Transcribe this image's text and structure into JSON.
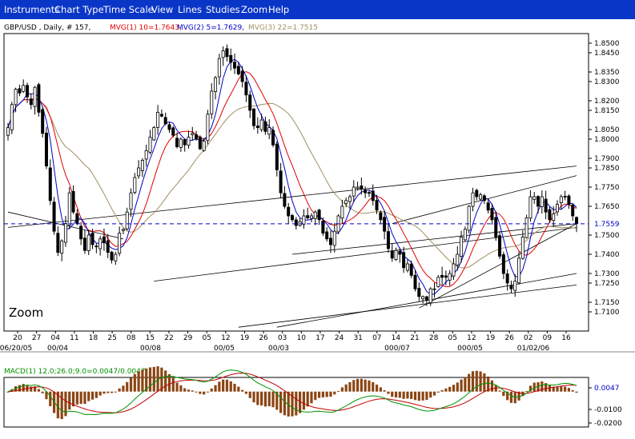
{
  "menu": [
    {
      "id": "instruments",
      "label": "Instruments"
    },
    {
      "id": "chart-type",
      "label": "Chart Type"
    },
    {
      "id": "time-scale",
      "label": "Time Scale"
    },
    {
      "id": "view",
      "label": "View"
    },
    {
      "id": "lines",
      "label": "Lines"
    },
    {
      "id": "studies",
      "label": "Studies"
    },
    {
      "id": "zoom",
      "label": "Zoom"
    },
    {
      "id": "help",
      "label": "Help"
    }
  ],
  "price_panel": {
    "header_symbol": "GBP/USD , Daily, # 157,",
    "mvg1": "MVG(1) 10=1.7643,",
    "mvg2": "MVG(2) 5=1.7629,",
    "mvg3": "MVG(3) 22=1.7515",
    "zoom_label": "Zoom",
    "current_price_tag": "1.7559"
  },
  "macd_panel": {
    "header": "MACD(1) 12.0;26.0;9.0=0.0047/0.0047",
    "value_tag": "0.0047",
    "ticks": [
      -0.01,
      -0.02
    ]
  },
  "colors": {
    "menu_bg": "#0a36c8",
    "mvg1": "#e00000",
    "mvg2": "#0000c8",
    "mvg3": "#a09060",
    "candle_up": "#ffffff",
    "candle_down": "#000000",
    "macd_bar": "#8b4513",
    "macd_line": "#009000",
    "signal_line": "#c00000",
    "price_marker": "#0000c8"
  },
  "chart_data": [
    {
      "type": "candlestick",
      "instrument": "GBP/USD",
      "interval": "Daily",
      "ylim": [
        1.7,
        1.855
      ],
      "yticks": [
        1.85,
        1.845,
        1.835,
        1.83,
        1.82,
        1.815,
        1.805,
        1.8,
        1.79,
        1.785,
        1.775,
        1.765,
        1.75,
        1.74,
        1.73,
        1.725,
        1.715,
        1.71
      ],
      "xticks": [
        "20",
        "27",
        "04",
        "11",
        "18",
        "25",
        "08",
        "15",
        "22",
        "29",
        "05",
        "12",
        "19",
        "26",
        "03",
        "10",
        "17",
        "24",
        "31",
        "07",
        "14",
        "21",
        "28",
        "05",
        "12",
        "19",
        "26",
        "02",
        "09",
        "16"
      ],
      "period_labels": [
        "06/20/05",
        "00/04",
        "00/08",
        "00/05",
        "00/03",
        "000/07",
        "000/05",
        "01/02/06"
      ],
      "current_price": 1.7559,
      "closes": [
        1.806,
        1.818,
        1.826,
        1.824,
        1.828,
        1.822,
        1.818,
        1.827,
        1.814,
        1.803,
        1.786,
        1.768,
        1.752,
        1.741,
        1.747,
        1.756,
        1.772,
        1.762,
        1.756,
        1.748,
        1.742,
        1.75,
        1.745,
        1.744,
        1.748,
        1.746,
        1.741,
        1.737,
        1.74,
        1.751,
        1.753,
        1.762,
        1.772,
        1.78,
        1.785,
        1.789,
        1.794,
        1.801,
        1.806,
        1.814,
        1.812,
        1.808,
        1.805,
        1.802,
        1.796,
        1.8,
        1.797,
        1.801,
        1.803,
        1.8,
        1.795,
        1.799,
        1.813,
        1.825,
        1.832,
        1.842,
        1.846,
        1.843,
        1.84,
        1.837,
        1.834,
        1.83,
        1.823,
        1.815,
        1.807,
        1.806,
        1.81,
        1.804,
        1.806,
        1.797,
        1.784,
        1.772,
        1.765,
        1.76,
        1.758,
        1.755,
        1.757,
        1.76,
        1.759,
        1.76,
        1.762,
        1.758,
        1.751,
        1.748,
        1.745,
        1.752,
        1.76,
        1.765,
        1.768,
        1.77,
        1.775,
        1.775,
        1.774,
        1.772,
        1.772,
        1.768,
        1.763,
        1.758,
        1.752,
        1.743,
        1.738,
        1.742,
        1.74,
        1.733,
        1.735,
        1.729,
        1.722,
        1.718,
        1.718,
        1.716,
        1.722,
        1.722,
        1.728,
        1.728,
        1.728,
        1.73,
        1.735,
        1.74,
        1.749,
        1.753,
        1.765,
        1.772,
        1.77,
        1.771,
        1.768,
        1.763,
        1.758,
        1.749,
        1.739,
        1.73,
        1.725,
        1.722,
        1.726,
        1.738,
        1.749,
        1.759,
        1.77,
        1.77,
        1.765,
        1.77,
        1.762,
        1.758,
        1.761,
        1.766,
        1.77,
        1.77,
        1.766,
        1.76,
        1.756
      ]
    },
    {
      "type": "line",
      "name": "MVG(1) 10",
      "last_value": 1.7643
    },
    {
      "type": "line",
      "name": "MVG(2) 5",
      "last_value": 1.7629
    },
    {
      "type": "line",
      "name": "MVG(3) 22",
      "last_value": 1.7515
    },
    {
      "type": "bar",
      "name": "MACD(1) 12.0;26.0;9.0",
      "last_value": 0.0047,
      "signal_last_value": 0.0047,
      "yticks": [
        0.0047,
        -0.01,
        -0.02
      ]
    }
  ]
}
